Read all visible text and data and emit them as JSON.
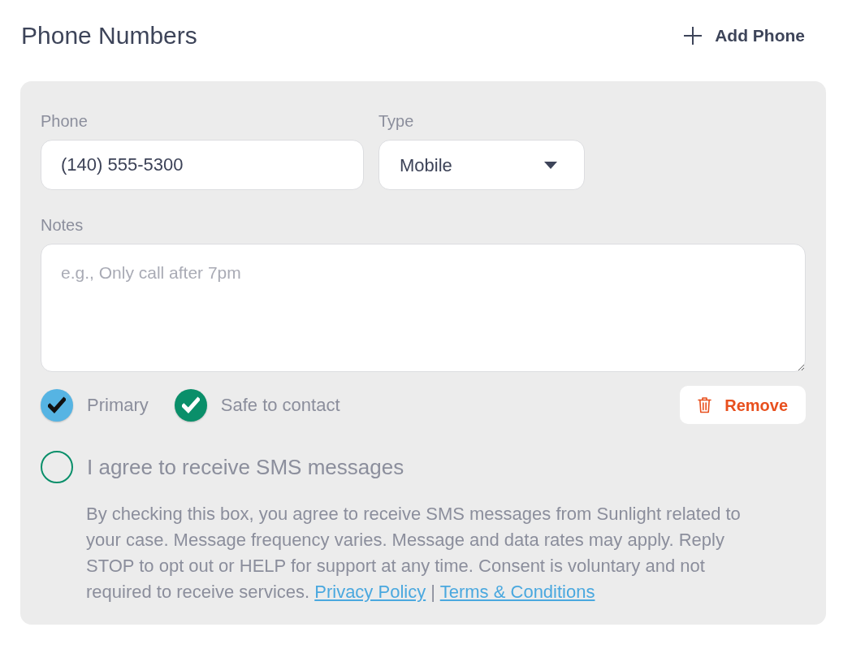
{
  "section": {
    "title": "Phone Numbers",
    "add_button": {
      "label": "Add Phone"
    }
  },
  "phone_entry": {
    "phone": {
      "label": "Phone",
      "value": "(140) 555-5300"
    },
    "type": {
      "label": "Type",
      "value": "Mobile"
    },
    "notes": {
      "label": "Notes",
      "placeholder": "e.g., Only call after 7pm"
    },
    "options": [
      {
        "label": "Primary",
        "checked": true,
        "color": "#56b4e3"
      },
      {
        "label": "Safe to contact",
        "checked": true,
        "color": "#0a8f6a"
      }
    ],
    "remove_button": {
      "label": "Remove"
    },
    "sms_consent": {
      "label": "I agree to receive SMS messages",
      "checked": false,
      "disclaimer": "By checking this box, you agree to receive SMS messages from Sunlight related to your case. Message frequency varies. Message and data rates may apply. Reply STOP to opt out or HELP for support at any time. Consent is voluntary and not required to receive services.",
      "links": [
        {
          "label": "Privacy Policy"
        },
        {
          "label": "Terms & Conditions"
        }
      ],
      "separator": "|"
    }
  }
}
